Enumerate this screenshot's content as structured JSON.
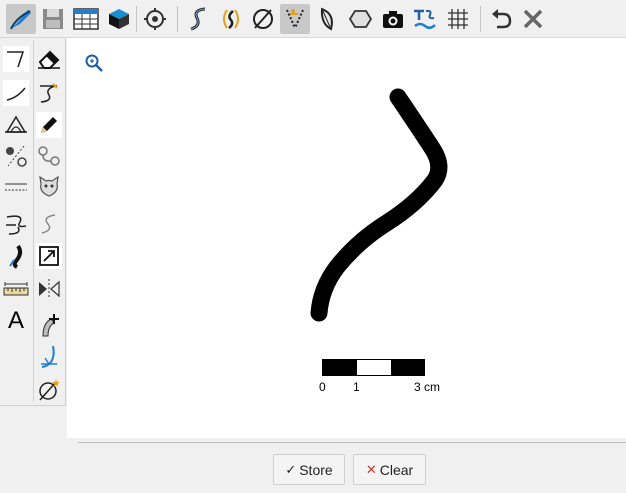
{
  "toolbar": {
    "items": [
      {
        "name": "draw-profile-icon",
        "active": true
      },
      {
        "name": "save-disk-icon"
      },
      {
        "name": "table-grid-icon"
      },
      {
        "name": "3d-cube-icon"
      },
      {
        "name": "target-icon"
      },
      {
        "name": "s-curve-icon"
      },
      {
        "name": "rotate-curve-icon"
      },
      {
        "name": "empty-set-icon"
      },
      {
        "name": "funnel-select-icon",
        "active": true
      },
      {
        "name": "leaf-shape-icon"
      },
      {
        "name": "hexagon-icon"
      },
      {
        "name": "camera-icon"
      },
      {
        "name": "text-brush-icon"
      },
      {
        "name": "grid-icon"
      },
      {
        "name": "undo-icon"
      },
      {
        "name": "close-x-icon"
      }
    ]
  },
  "sidebar": {
    "left_column": [
      "corner-line-icon",
      "curve-line-icon",
      "triangle-hat-icon",
      "dots-slash-icon",
      "dashed-lines-icon",
      "s-hook-icon",
      "brush-stroke-icon",
      "ruler-icon",
      "text-a-icon"
    ],
    "right_column": [
      "eraser-icon",
      "curve-hook-icon",
      "pencil-icon",
      "handles-icon",
      "cat-face-icon",
      "thin-s-icon",
      "resize-box-icon",
      "mirror-icon",
      "knife-curve-icon",
      "blue-pen-icon",
      "empty-set-star-icon"
    ],
    "text_glyph": "A"
  },
  "canvas": {
    "zoom_icon": "zoom-icon",
    "scale_bar": {
      "labels": [
        "0",
        "1",
        "3 cm"
      ]
    }
  },
  "buttons": {
    "store": {
      "glyph": "✓",
      "label": "Store"
    },
    "clear": {
      "glyph": "✕",
      "label": "Clear"
    }
  },
  "colors": {
    "accent_blue": "#1f7fd0",
    "toolbar_bg": "#f0f0f0",
    "active_bg": "#c8c8c8",
    "ink": "#000000"
  }
}
